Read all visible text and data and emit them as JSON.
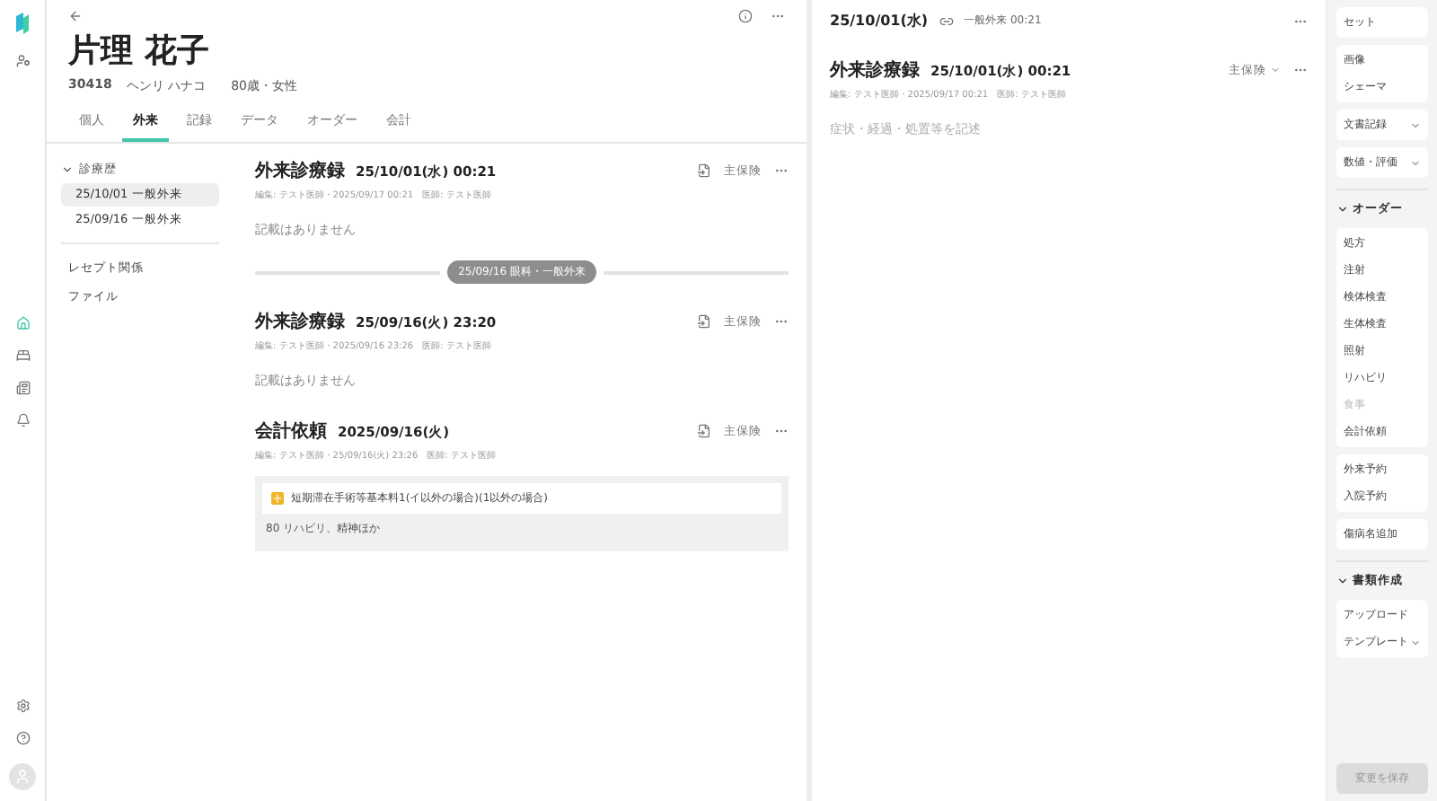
{
  "patient": {
    "name": "片理 花子",
    "id": "30418",
    "kana": "ヘンリ ハナコ",
    "info": "80歳・女性"
  },
  "tabs": [
    {
      "label": "個人",
      "selected": false
    },
    {
      "label": "外来",
      "selected": true
    },
    {
      "label": "記録",
      "selected": false
    },
    {
      "label": "データ",
      "selected": false
    },
    {
      "label": "オーダー",
      "selected": false
    },
    {
      "label": "会計",
      "selected": false
    }
  ],
  "sidebar": {
    "history": {
      "label": "診療歴",
      "expanded": true,
      "items": [
        {
          "label": "25/10/01 一般外来",
          "selected": true
        },
        {
          "label": "25/09/16 一般外来",
          "selected": false
        }
      ]
    },
    "links": [
      "レセプト関係",
      "ファイル"
    ]
  },
  "records": [
    {
      "kind": "note",
      "title": "外来診療録",
      "date": "25/10/01(水) 00:21",
      "meta": "編集: テスト医師・2025/09/17 00:21　医師: テスト医師",
      "insurance": "主保険",
      "body": "記載はありません"
    },
    {
      "kind": "divider",
      "label": "25/09/16 眼科・一般外来"
    },
    {
      "kind": "note",
      "title": "外来診療録",
      "date": "25/09/16(火) 23:20",
      "meta": "編集: テスト医師・2025/09/16 23:26　医師: テスト医師",
      "insurance": "主保険",
      "body": "記載はありません"
    },
    {
      "kind": "billing",
      "title": "会計依頼",
      "date": "2025/09/16(火)",
      "meta": "編集: テスト医師・25/09/16(火) 23:26　医師: テスト医師",
      "insurance": "主保険",
      "item": "短期滞在手術等基本料1(イ以外の場合)(1以外の場合)",
      "note": "80 リハビリ、精神ほか"
    }
  ],
  "editor": {
    "date": "25/10/01(水)",
    "visit": "一般外来 00:21",
    "title": "外来診療録",
    "title_date": "25/10/01(水) 00:21",
    "insurance": "主保険",
    "meta": "編集: テスト医師・2025/09/17 00:21　医師: テスト医師",
    "placeholder": "症状・経過・処置等を記述"
  },
  "actions": [
    {
      "kind": "group",
      "items": [
        {
          "label": "セット",
          "dropdown": false,
          "disabled": false
        }
      ]
    },
    {
      "kind": "group",
      "items": [
        {
          "label": "画像",
          "dropdown": false,
          "disabled": false
        },
        {
          "label": "シェーマ",
          "dropdown": false,
          "disabled": false
        }
      ]
    },
    {
      "kind": "group",
      "items": [
        {
          "label": "文書記録",
          "dropdown": true,
          "disabled": false
        }
      ]
    },
    {
      "kind": "group",
      "items": [
        {
          "label": "数値・評価",
          "dropdown": true,
          "disabled": false
        }
      ]
    },
    {
      "kind": "section",
      "label": "オーダー",
      "expanded": true
    },
    {
      "kind": "group",
      "items": [
        {
          "label": "処方",
          "dropdown": false,
          "disabled": false
        },
        {
          "label": "注射",
          "dropdown": false,
          "disabled": false
        },
        {
          "label": "検体検査",
          "dropdown": false,
          "disabled": false
        },
        {
          "label": "生体検査",
          "dropdown": false,
          "disabled": false
        },
        {
          "label": "照射",
          "dropdown": false,
          "disabled": false
        },
        {
          "label": "リハビリ",
          "dropdown": false,
          "disabled": false
        },
        {
          "label": "食事",
          "dropdown": false,
          "disabled": true
        },
        {
          "label": "会計依頼",
          "dropdown": false,
          "disabled": false
        }
      ]
    },
    {
      "kind": "group",
      "items": [
        {
          "label": "外来予約",
          "dropdown": false,
          "disabled": false
        },
        {
          "label": "入院予約",
          "dropdown": false,
          "disabled": false
        }
      ]
    },
    {
      "kind": "group",
      "items": [
        {
          "label": "傷病名追加",
          "dropdown": false,
          "disabled": false
        }
      ]
    },
    {
      "kind": "section",
      "label": "書類作成",
      "expanded": true
    },
    {
      "kind": "group",
      "items": [
        {
          "label": "アップロード",
          "dropdown": false,
          "disabled": false
        },
        {
          "label": "テンプレート",
          "dropdown": true,
          "disabled": false
        }
      ]
    }
  ],
  "save": {
    "label": "変更を保存",
    "disabled": true
  }
}
